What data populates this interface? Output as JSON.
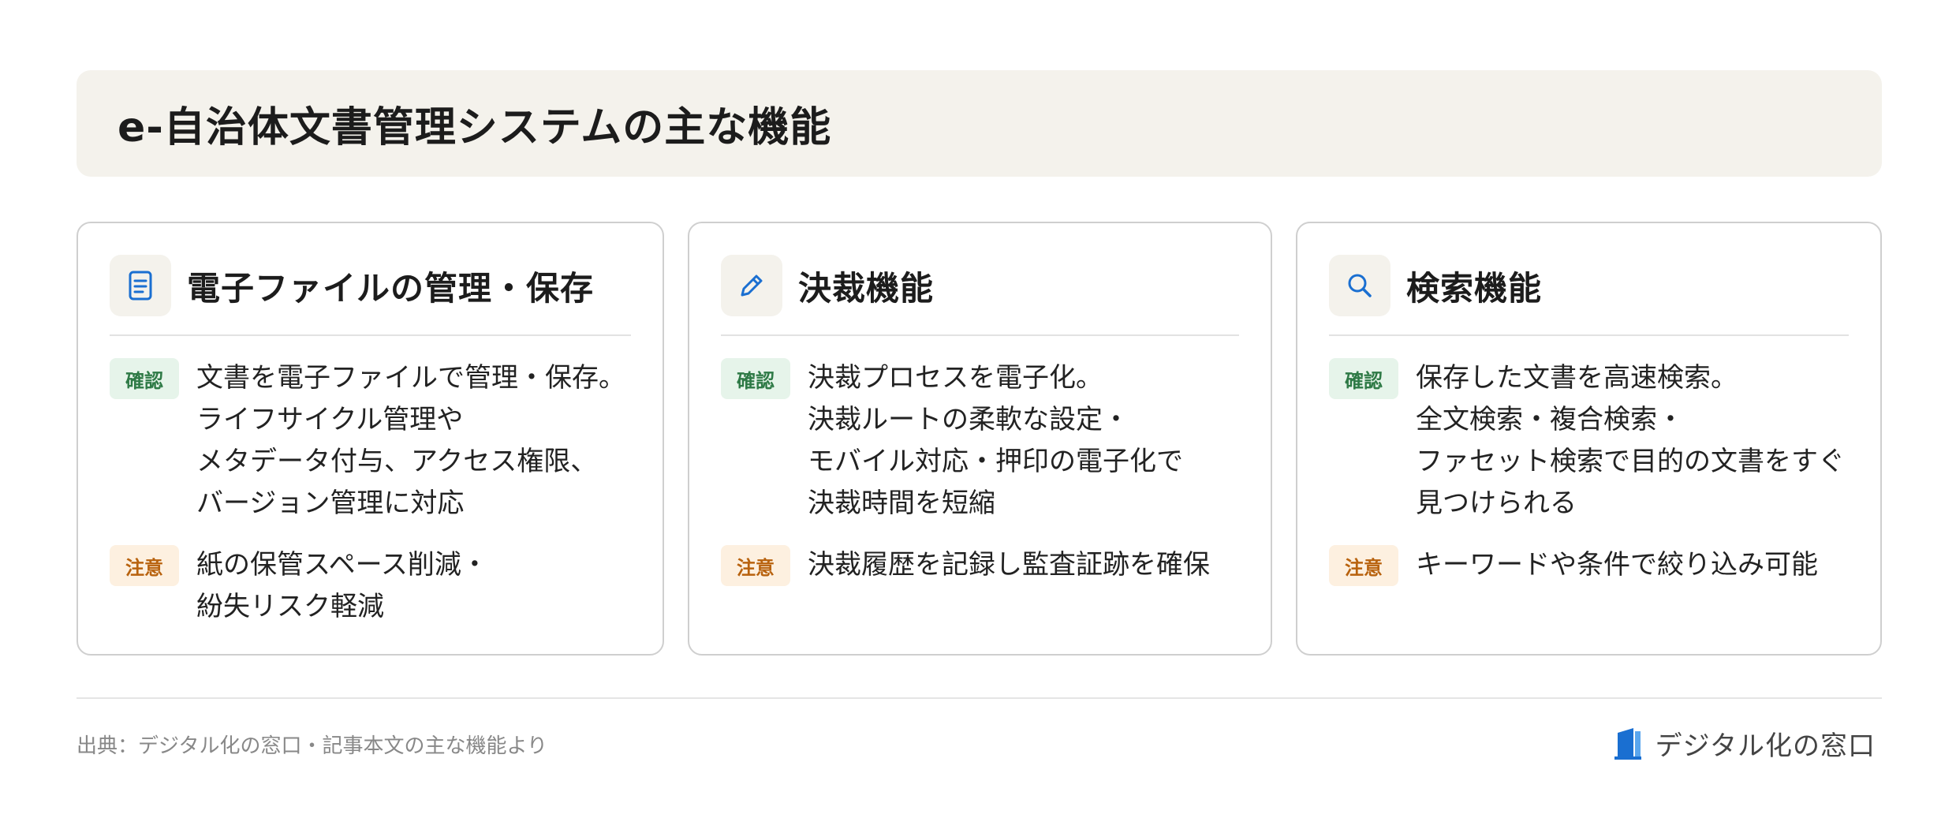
{
  "title": "e-自治体文書管理システムの主な機能",
  "labels": {
    "confirm": "確認",
    "note": "注意"
  },
  "cards": [
    {
      "icon": "document-icon",
      "title": "電子ファイルの管理・保存",
      "confirm": "文書を電子ファイルで管理・保存。\nライフサイクル管理や\nメタデータ付与、アクセス権限、\nバージョン管理に対応",
      "note": "紙の保管スペース削減・\n紛失リスク軽減"
    },
    {
      "icon": "pencil-icon",
      "title": "決裁機能",
      "confirm": "決裁プロセスを電子化。\n決裁ルートの柔軟な設定・\nモバイル対応・押印の電子化で\n決裁時間を短縮",
      "note": "決裁履歴を記録し監査証跡を確保"
    },
    {
      "icon": "search-icon",
      "title": "検索機能",
      "confirm": "保存した文書を高速検索。\n全文検索・複合検索・\nファセット検索で目的の文書をすぐ\n見つけられる",
      "note": "キーワードや条件で絞り込み可能"
    }
  ],
  "footer": {
    "source": "出典：デジタル化の窓口・記事本文の主な機能より",
    "brand": "デジタル化の窓口"
  },
  "colors": {
    "accent_blue": "#1a6fd1",
    "confirm_bg": "#e6f4ea",
    "confirm_fg": "#2e7a46",
    "note_bg": "#fdf0e0",
    "note_fg": "#b8620e",
    "banner_bg": "#f4f2ec"
  }
}
